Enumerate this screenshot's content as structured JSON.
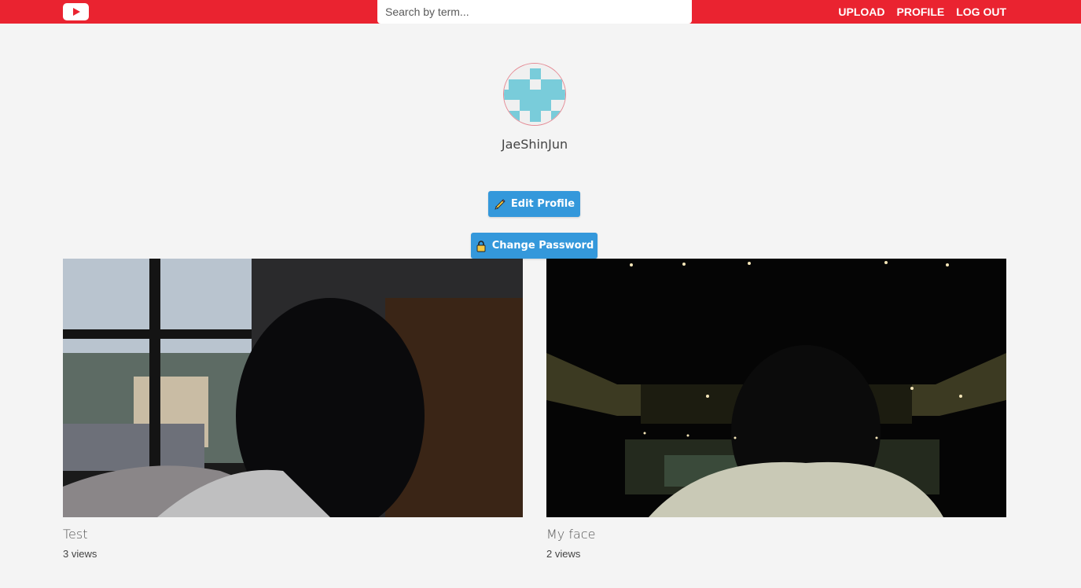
{
  "header": {
    "logo_icon": "youtube-play-icon",
    "search_placeholder": "Search by term...",
    "nav": [
      {
        "label": "UPLOAD"
      },
      {
        "label": "PROFILE"
      },
      {
        "label": "LOG OUT"
      }
    ],
    "accent_color": "#ea2330"
  },
  "profile": {
    "username": "JaeShinJun",
    "avatar_icon": "identicon-avatar",
    "edit_button_label": "Edit Profile",
    "edit_button_icon": "pencil-icon",
    "password_button_label": "Change Password",
    "password_button_icon": "lock-icon",
    "button_color": "#3498db"
  },
  "videos": [
    {
      "title": "Test",
      "views": "3 views"
    },
    {
      "title": "My face",
      "views": "2 views"
    }
  ]
}
